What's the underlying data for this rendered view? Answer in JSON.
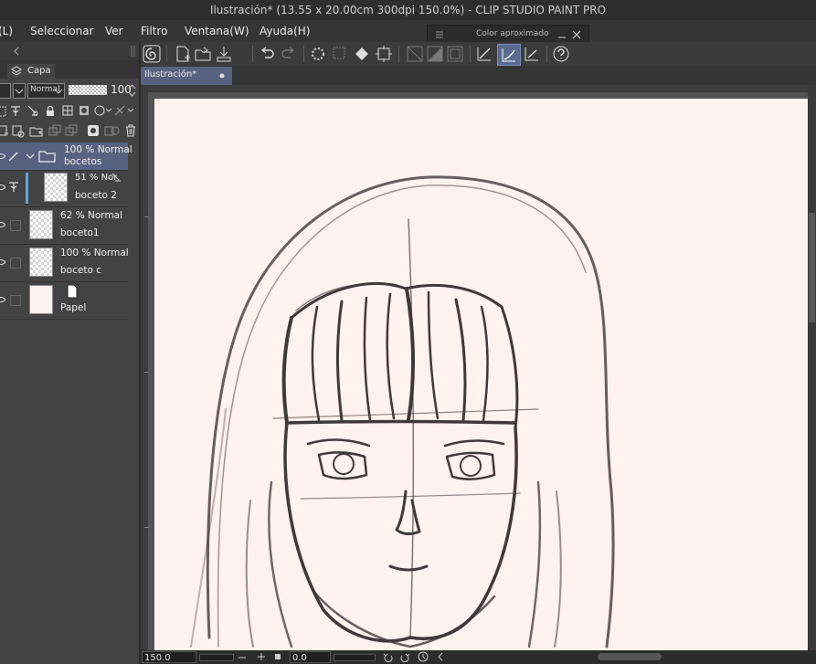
{
  "window": {
    "title": "Ilustración* (13.55 x 20.00cm 300dpi 150.0%) - CLIP STUDIO PAINT PRO"
  },
  "menu": {
    "items": [
      "(L)",
      "Seleccionar",
      "Ver",
      "Filtro",
      "Ventana(W)",
      "Ayuda(H)"
    ]
  },
  "floating_panel": {
    "title": "Color aproximado"
  },
  "layer_panel": {
    "tab_label": "Capa",
    "blend_mode": "Normal",
    "opacity": "100",
    "layers": [
      {
        "mode": "100 % Normal",
        "name": "bocetos",
        "type": "folder"
      },
      {
        "mode": "51 % Nor",
        "name": "boceto 2",
        "type": "raster"
      },
      {
        "mode": "62 % Normal",
        "name": "boceto1",
        "type": "raster"
      },
      {
        "mode": "100 % Normal",
        "name": "boceto c",
        "type": "raster"
      },
      {
        "mode": "",
        "name": "Papel",
        "type": "paper"
      }
    ]
  },
  "document": {
    "tab_label": "Ilustración*"
  },
  "status": {
    "zoom": "150.0",
    "angle": "0.0"
  },
  "colors": {
    "paper": "#fff2ef",
    "selection": "#56627f",
    "accent": "#5aa8d6",
    "ink": "#3a3a3a"
  }
}
